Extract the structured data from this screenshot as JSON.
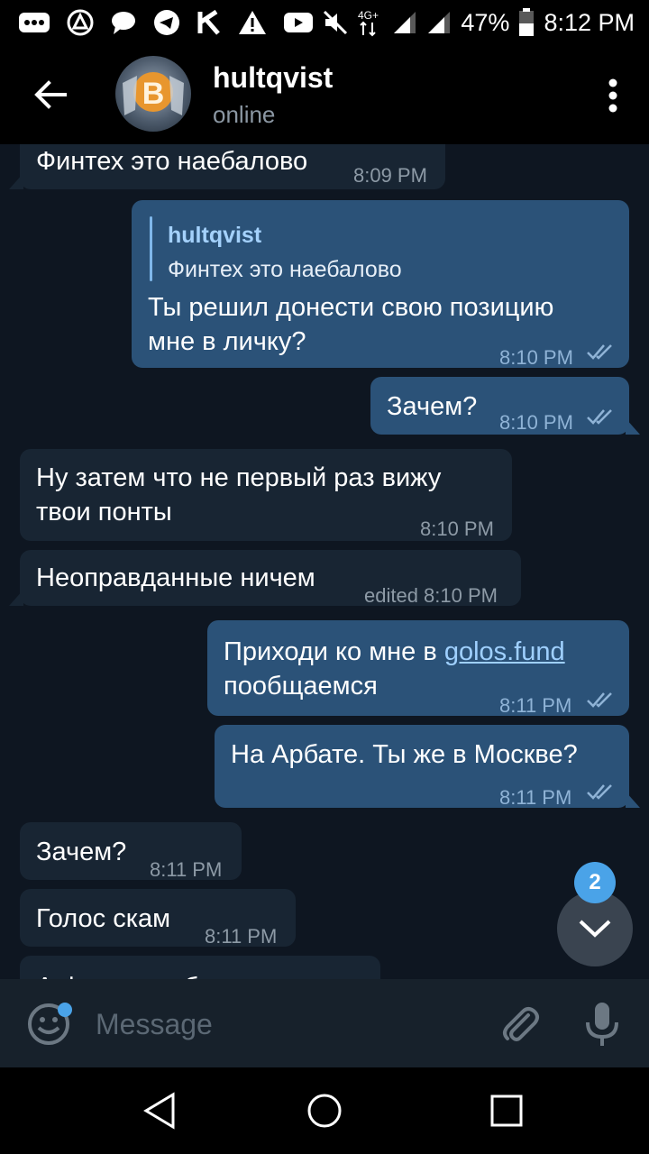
{
  "status_bar": {
    "network": "4G+",
    "battery": "47%",
    "time": "8:12 PM",
    "icons": [
      "more-icon",
      "nearby-icon",
      "chat-bubble-icon",
      "telegram-icon",
      "k-icon",
      "warning-icon",
      "youtube-icon",
      "mute-icon",
      "signal-icon",
      "signal-icon",
      "battery-icon"
    ]
  },
  "header": {
    "title": "hultqvist",
    "status": "online"
  },
  "messages": [
    {
      "id": "m1",
      "dir": "in",
      "text": "Финтех это наебалово",
      "time": "8:09 PM"
    },
    {
      "id": "m2",
      "dir": "out",
      "reply_name": "hultqvist",
      "reply_text": "Финтех это наебалово",
      "line1": "Ты решил донести свою позицию",
      "line2": "мне в личку?",
      "time": "8:10 PM"
    },
    {
      "id": "m3",
      "dir": "out",
      "text": "Зачем?",
      "time": "8:10 PM"
    },
    {
      "id": "m4",
      "dir": "in",
      "line1": "Ну затем что не первый раз вижу",
      "line2": "твои понты",
      "time": "8:10 PM"
    },
    {
      "id": "m5",
      "dir": "in",
      "text": "Неоправданные ничем",
      "time": "edited 8:10 PM"
    },
    {
      "id": "m6",
      "dir": "out",
      "prefix": "Приходи ко мне в ",
      "link": "golos.fund",
      "line2": "пообщаемся",
      "time": "8:11 PM"
    },
    {
      "id": "m7",
      "dir": "out",
      "text": "На Арбате. Ты же в Москве?",
      "time": "8:11 PM"
    },
    {
      "id": "m8",
      "dir": "in",
      "text": "Зачем?",
      "time": "8:11 PM"
    },
    {
      "id": "m9",
      "dir": "in",
      "text": "Голос скам",
      "time": "8:11 PM"
    },
    {
      "id": "m10",
      "dir": "in",
      "text": "А фуил там более",
      "time": ""
    }
  ],
  "scroll_badge": "2",
  "input": {
    "placeholder": "Message"
  },
  "colors": {
    "background": "#0e1621",
    "incoming": "#182533",
    "outgoing": "#2b5278",
    "accent": "#4aa3e8"
  }
}
